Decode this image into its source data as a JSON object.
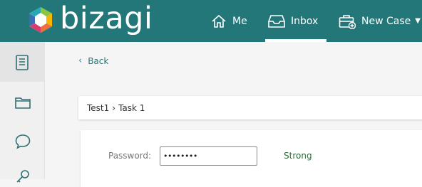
{
  "header": {
    "logo_text": "bizagi",
    "nav": {
      "me": "Me",
      "inbox": "Inbox",
      "new_case": "New Case"
    },
    "icons": [
      "home-icon",
      "inbox-tray-icon",
      "briefcase-add-icon",
      "caret-down-icon"
    ]
  },
  "sidebar": {
    "items": [
      {
        "icon": "list-document-icon",
        "active": true
      },
      {
        "icon": "folder-icon",
        "active": false
      },
      {
        "icon": "chat-bubble-icon",
        "active": false
      },
      {
        "icon": "key-icon",
        "active": false
      }
    ]
  },
  "main": {
    "back_label": "Back",
    "breadcrumb": {
      "case": "Test1",
      "separator": "›",
      "task": "Task 1"
    },
    "form": {
      "password_label": "Password:",
      "password_value": "••••••••",
      "strength_text": "Strong"
    }
  },
  "colors": {
    "header_bg": "#237779",
    "accent": "#237779",
    "strength": "#2e6b3a"
  }
}
